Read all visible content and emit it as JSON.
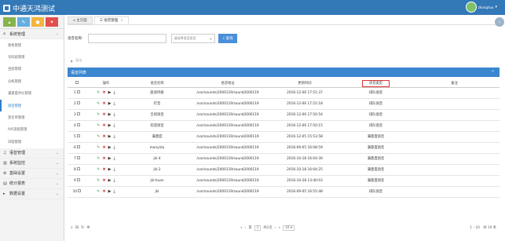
{
  "app": {
    "title": "中通天鸿测试",
    "user": "zhonghua"
  },
  "shortcut_colors": [
    "#87b34d",
    "#66aee0",
    "#f2b43f",
    "#e2504b"
  ],
  "sidebar": {
    "groups": [
      {
        "label": "系统管理",
        "icon": "home-icon"
      },
      {
        "label": "语音管理",
        "icon": "music-icon"
      },
      {
        "label": "系统监控",
        "icon": "chart-icon"
      },
      {
        "label": "基础设置",
        "icon": "gears-icon"
      },
      {
        "label": "统计报表",
        "icon": "table-icon"
      },
      {
        "label": "数据设置",
        "icon": "caret-right-icon"
      }
    ],
    "sub_items": [
      "角色管理",
      "号码段管理",
      "坐席管理",
      "分机管理",
      "满意度评价管理",
      "语音管理",
      "黑名单管理",
      "IVR流程管理",
      "日程管理"
    ],
    "active_sub": 5
  },
  "tabs": [
    {
      "label": "主页面"
    },
    {
      "label": "语音管理"
    }
  ],
  "search": {
    "name_label": "语音名称:",
    "type_placeholder": "请选择语音类型",
    "button": "查询"
  },
  "toolbar": {
    "label": "导出"
  },
  "panel": {
    "title": "语音列表"
  },
  "table": {
    "headers": [
      "",
      "操作",
      "语音名称",
      "语音地址",
      "更新时间",
      "语音类型",
      "备注"
    ],
    "rows": [
      {
        "n": "1",
        "name": "座语待接",
        "addr": "/var/sounds/2000119/sound2000119",
        "time": "2016-12-06 17:51:37",
        "type": "排队语音"
      },
      {
        "n": "2",
        "name": "打音",
        "addr": "/var/sounds/2000119/sound2000119",
        "time": "2016-12-06 17:51:18",
        "type": "排队语音"
      },
      {
        "n": "3",
        "name": "全班语音",
        "addr": "/var/sounds/2000119/sound2000119",
        "time": "2016-12-06 17:50:54",
        "type": "排队语音"
      },
      {
        "n": "4",
        "name": "欢迎语音",
        "addr": "/var/sounds/2000119/sound2000119",
        "time": "2016-12-06 17:50:15",
        "type": "排队语音"
      },
      {
        "n": "5",
        "name": "满意度",
        "addr": "/var/sounds/2000119/sound2000119",
        "time": "2016-12-05 15:53:58",
        "type": "满意度语音"
      },
      {
        "n": "6",
        "name": "manyidu",
        "addr": "/var/sounds/2000119/sound2000119",
        "time": "2016-09-05 16:08:59",
        "type": "满意度语音"
      },
      {
        "n": "7",
        "name": "jkl-4",
        "addr": "/var/sounds/2000119/sound2000119",
        "time": "2016-10-18 16:04:30",
        "type": "满意度语音"
      },
      {
        "n": "8",
        "name": "jkl-2",
        "addr": "/var/sounds/2000119/sound2000119",
        "time": "2016-10-18 16:04:25",
        "type": "满意度语音"
      },
      {
        "n": "9",
        "name": "jkl-huan",
        "addr": "/var/sounds/2000119/sound2000119",
        "time": "2016-10-28 13:40:03",
        "type": "满意度语音"
      },
      {
        "n": "10",
        "name": "jkl",
        "addr": "/var/sounds/2000119/sound2000119",
        "time": "2016-09-05 16:55:48",
        "type": "排队语音"
      }
    ]
  },
  "pager": {
    "page_prefix": "第",
    "page_value": "1",
    "page_suffix": "共2页",
    "size": "10",
    "summary": "1 - 10　共 19 条"
  }
}
